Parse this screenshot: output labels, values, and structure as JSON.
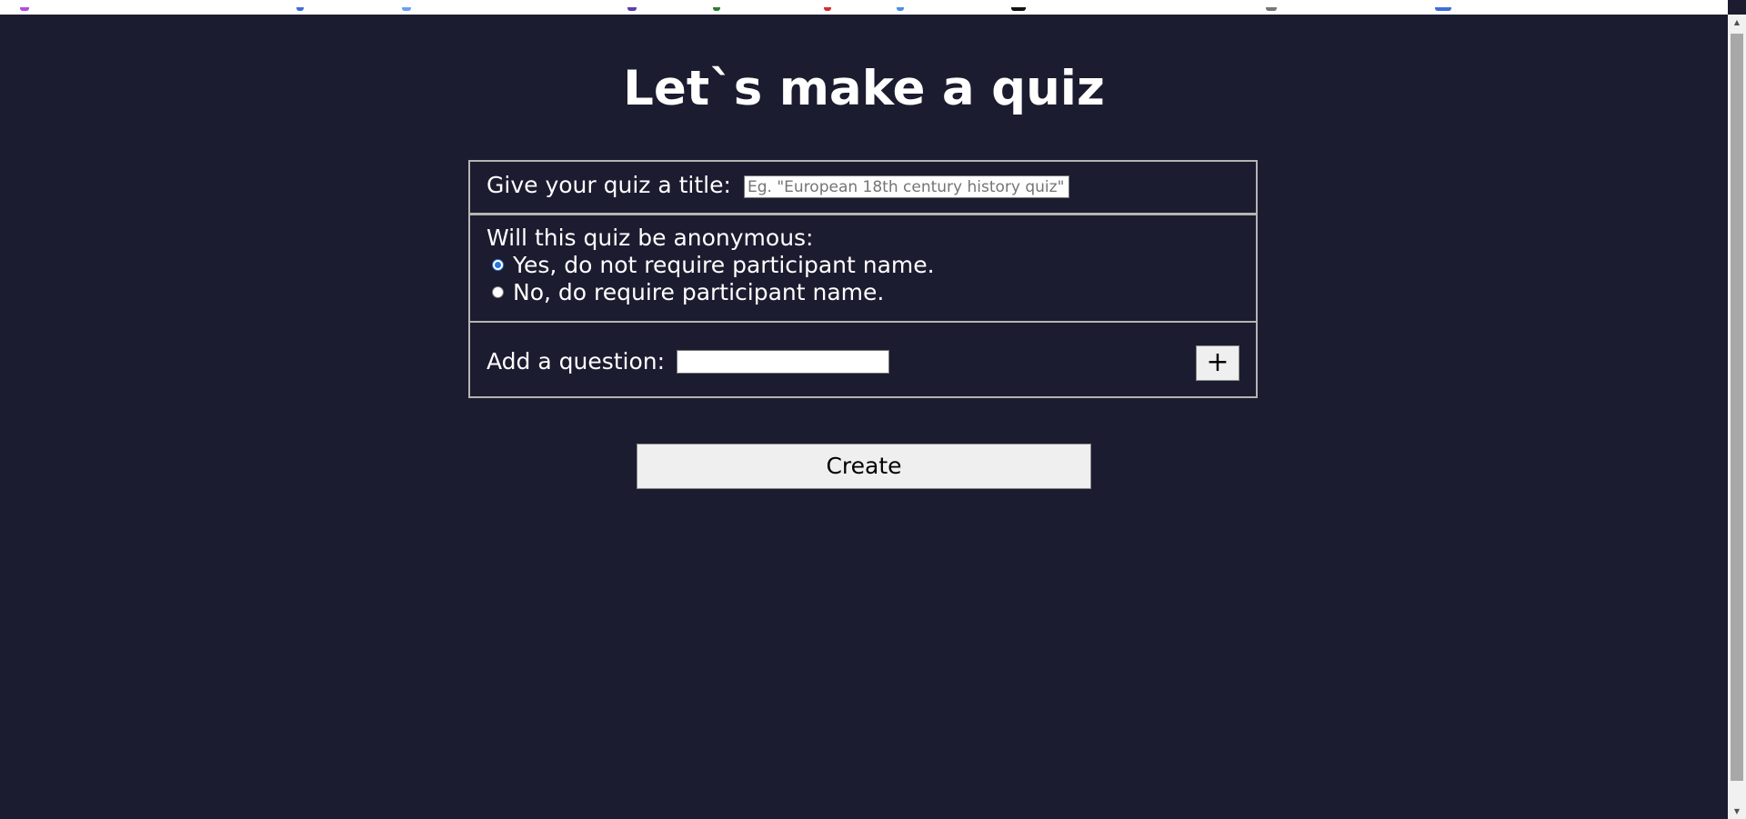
{
  "page": {
    "title": "Let`s make a quiz"
  },
  "quiz_title": {
    "label": "Give your quiz a title:",
    "value": "",
    "placeholder": "Eg. \"European 18th century history quiz\""
  },
  "anonymity": {
    "question": "Will this quiz be anonymous:",
    "options": [
      {
        "label": "Yes, do not require participant name.",
        "checked": true
      },
      {
        "label": "No, do require participant name.",
        "checked": false
      }
    ]
  },
  "add_question": {
    "label": "Add a question:",
    "value": "",
    "button_label": "+"
  },
  "create_button": {
    "label": "Create"
  },
  "colors": {
    "background": "#1c1c30",
    "text": "#ffffff",
    "panel_border": "#b4b4b4",
    "radio_accent": "#2b74d9",
    "button_background": "#efefef"
  }
}
